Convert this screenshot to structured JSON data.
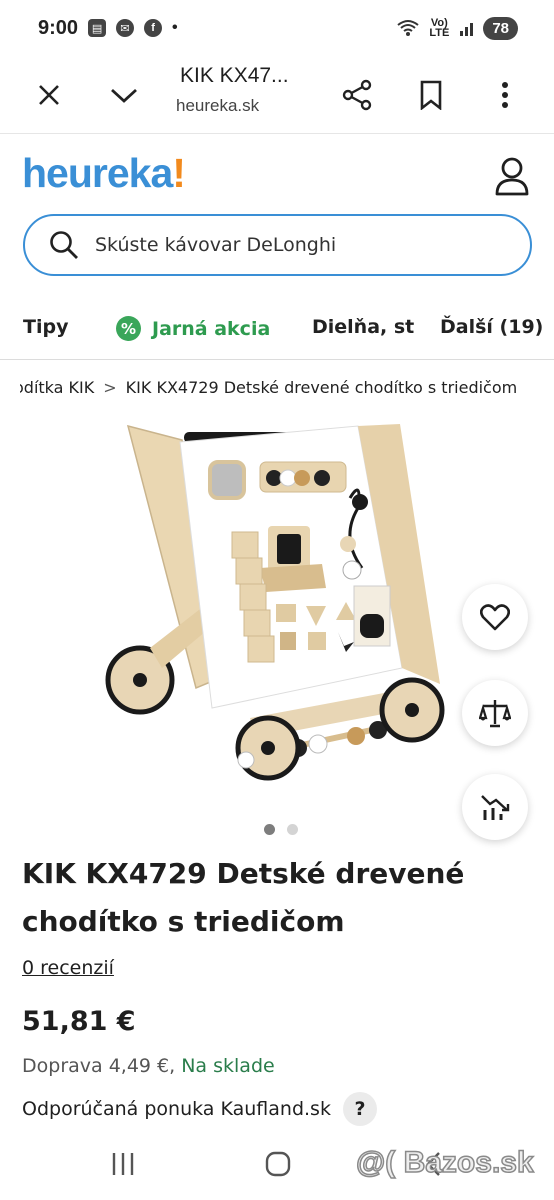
{
  "status_bar": {
    "time": "9:00",
    "network": "Vo) LTE",
    "battery": "78"
  },
  "browser": {
    "tab_title": "KIK KX47...",
    "url": "heureka.sk"
  },
  "site": {
    "logo_text": "heureka",
    "logo_mark": "!",
    "colors": {
      "brand_blue": "#3a8fd6",
      "brand_orange": "#f28a1d",
      "promo_green": "#2e9b4f"
    }
  },
  "search": {
    "placeholder": "Skúste kávovar DeLonghi"
  },
  "categories": [
    {
      "label": "Tipy"
    },
    {
      "label": "Jarná akcia",
      "badge": "%"
    },
    {
      "label": "Dielňa, st"
    },
    {
      "label": "Ďalší (19)"
    }
  ],
  "breadcrumb": [
    {
      "label": "odítka KIK"
    },
    {
      "label": "KIK KX4729 Detské drevené chodítko s triedičom"
    }
  ],
  "breadcrumb_separator": ">",
  "gallery": {
    "dots": 2,
    "active_dot": 0
  },
  "actions": [
    {
      "name": "favorite",
      "icon": "heart-icon"
    },
    {
      "name": "compare",
      "icon": "scale-icon"
    },
    {
      "name": "price-history",
      "icon": "price-chart-icon"
    }
  ],
  "product": {
    "title": "KIK KX4729 Detské drevené chodítko s triedičom",
    "reviews_link": "0 recenzií",
    "price": "51,81 €",
    "shipping_label": "Doprava 4,49 €,",
    "stock": "Na sklade",
    "offer": "Odporúčaná ponuka Kaufland.sk",
    "help": "?"
  },
  "watermark": "@( Bazos.sk"
}
